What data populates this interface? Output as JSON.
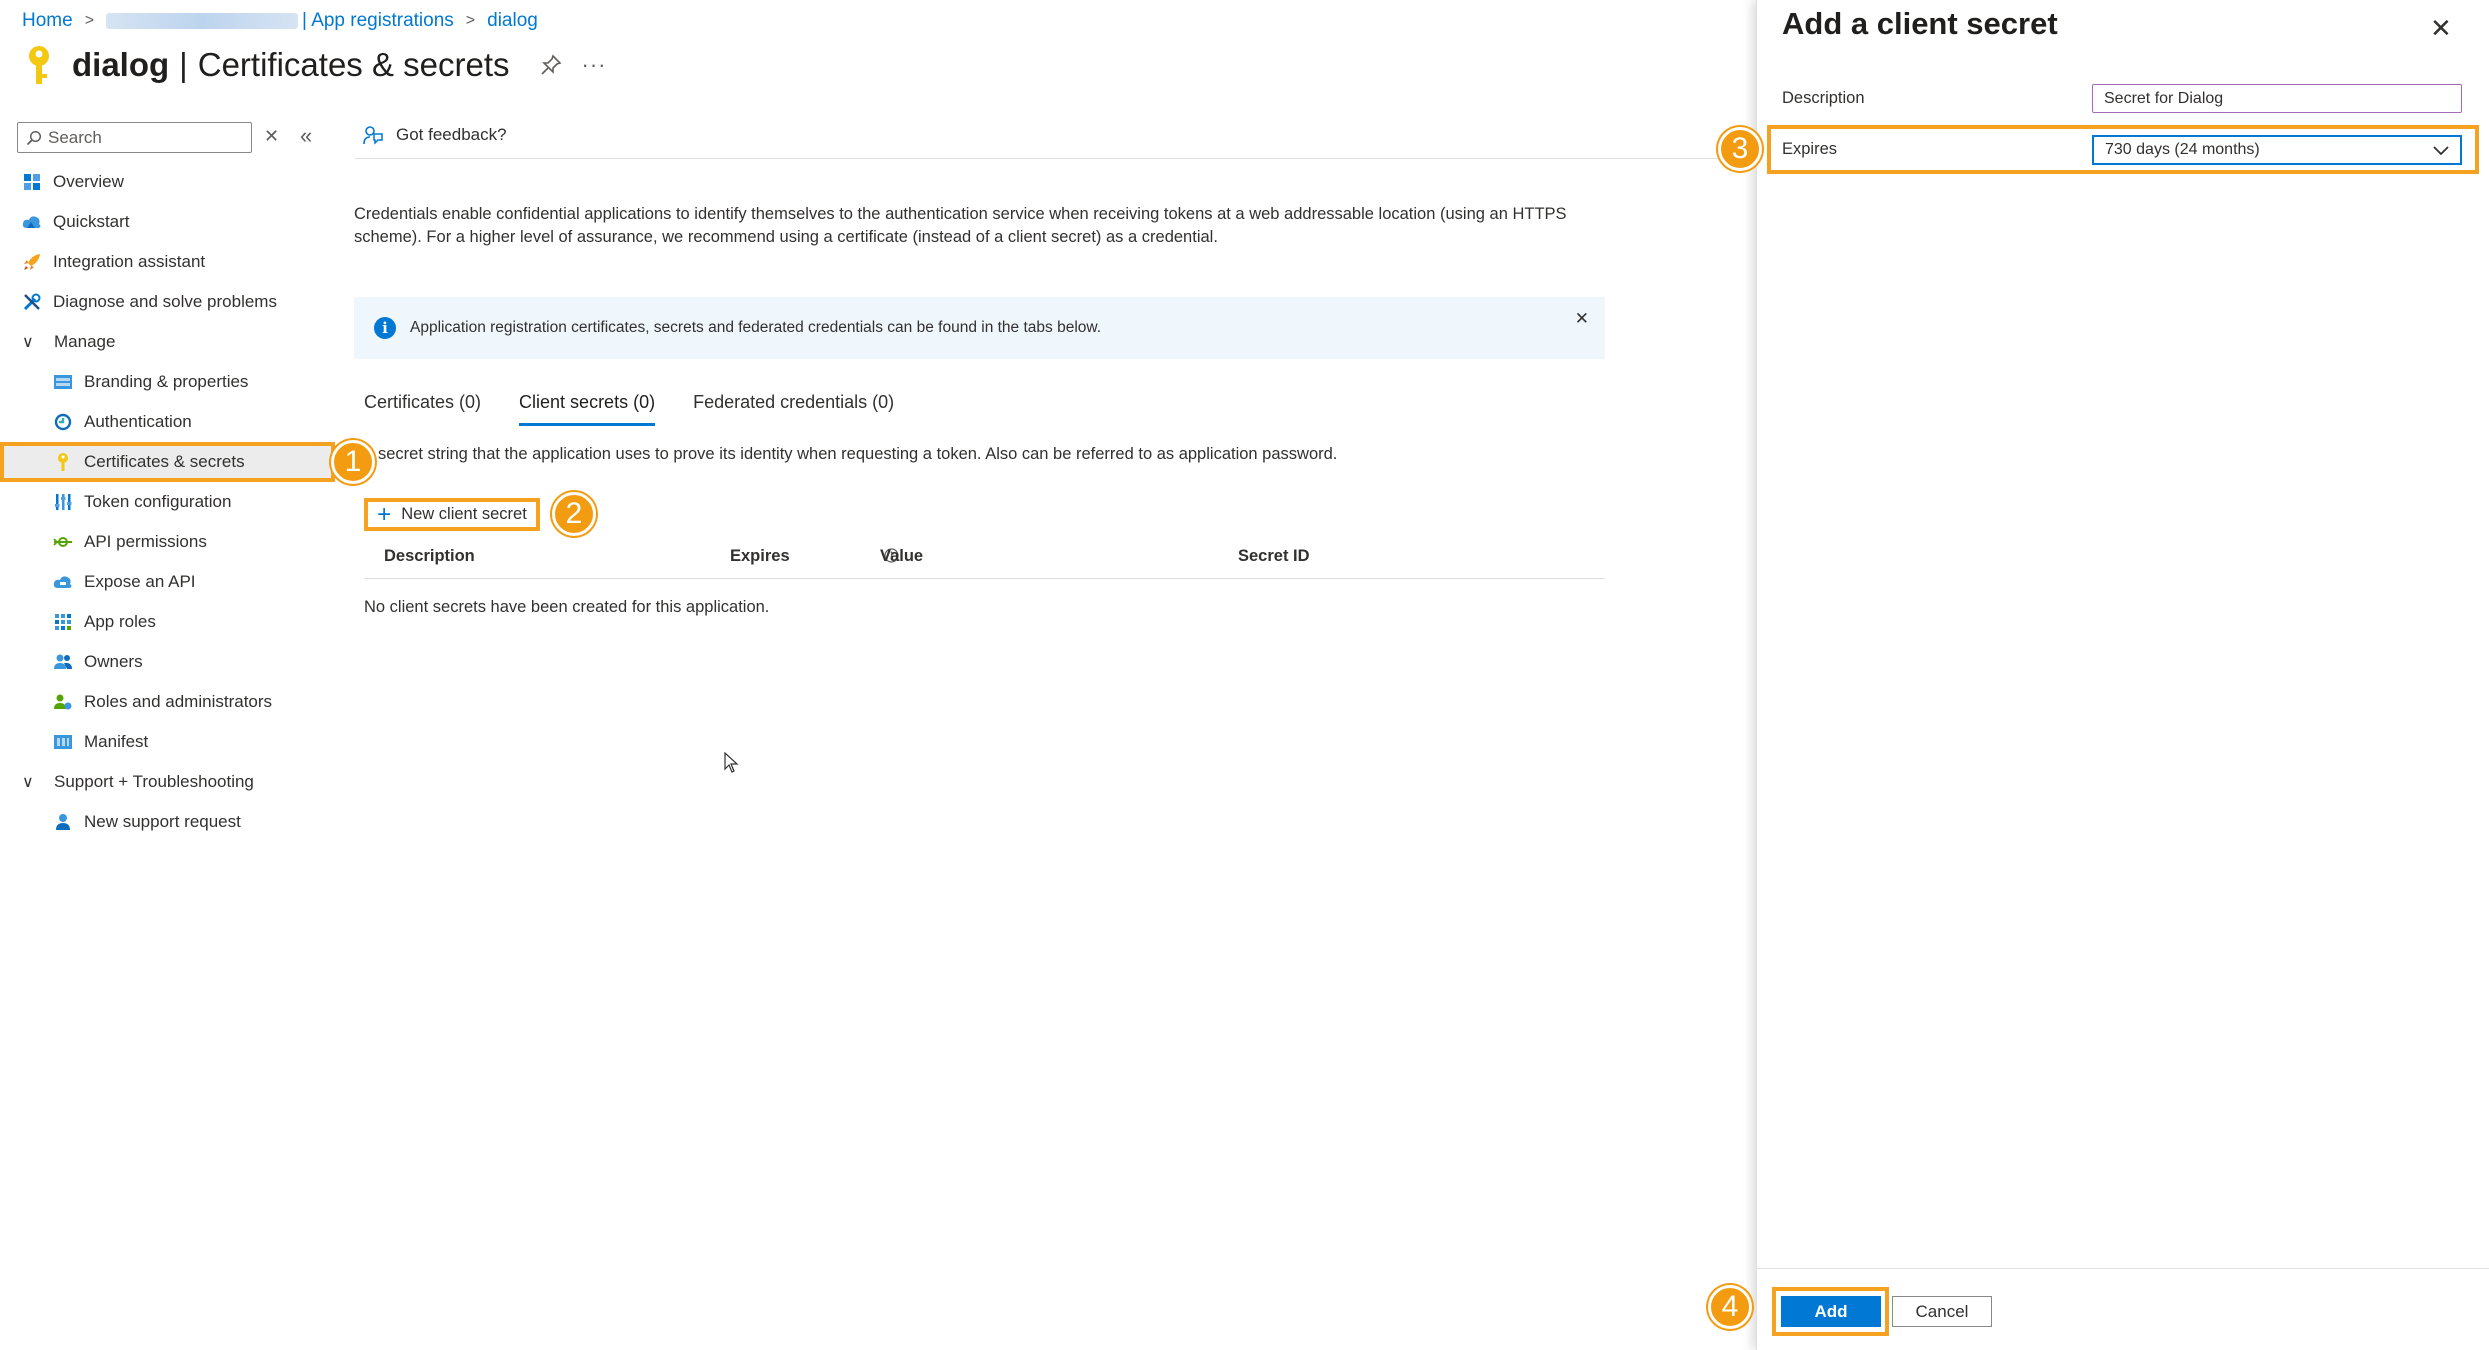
{
  "breadcrumb": {
    "home": "Home",
    "tenant_suffix": "| App registrations",
    "app": "dialog"
  },
  "page": {
    "title_name": "dialog",
    "title_separator": "|",
    "title_section": "Certificates & secrets",
    "more": "···"
  },
  "search": {
    "placeholder": "Search"
  },
  "sidebar": {
    "items": [
      {
        "label": "Overview",
        "icon": "overview-grid-icon"
      },
      {
        "label": "Quickstart",
        "icon": "quickstart-cloud-icon"
      },
      {
        "label": "Integration assistant",
        "icon": "rocket-icon"
      },
      {
        "label": "Diagnose and solve problems",
        "icon": "wrench-icon"
      }
    ],
    "manage_label": "Manage",
    "manage_items": [
      {
        "label": "Branding & properties",
        "icon": "branding-icon"
      },
      {
        "label": "Authentication",
        "icon": "authentication-icon"
      },
      {
        "label": "Certificates & secrets",
        "icon": "key-icon"
      },
      {
        "label": "Token configuration",
        "icon": "token-bars-icon"
      },
      {
        "label": "API permissions",
        "icon": "api-permissions-icon"
      },
      {
        "label": "Expose an API",
        "icon": "cloud-api-icon"
      },
      {
        "label": "App roles",
        "icon": "app-roles-grid-icon"
      },
      {
        "label": "Owners",
        "icon": "owners-people-icon"
      },
      {
        "label": "Roles and administrators",
        "icon": "roles-admin-icon"
      },
      {
        "label": "Manifest",
        "icon": "manifest-icon"
      }
    ],
    "support_label": "Support + Troubleshooting",
    "support_items": [
      {
        "label": "New support request",
        "icon": "support-person-icon"
      }
    ]
  },
  "content": {
    "feedback": "Got feedback?",
    "intro_line1": "Credentials enable confidential applications to identify themselves to the authentication service when receiving tokens at a web addressable location (using an HTTPS",
    "intro_line2": "scheme). For a higher level of assurance, we recommend using a certificate (instead of a client secret) as a credential.",
    "info_bar": "Application registration certificates, secrets and federated credentials can be found in the tabs below.",
    "tabs": [
      {
        "label": "Certificates (0)"
      },
      {
        "label": "Client secrets (0)"
      },
      {
        "label": "Federated credentials (0)"
      }
    ],
    "tab_description": "secret string that the application uses to prove its identity when requesting a token. Also can be referred to as application password.",
    "new_secret_button": "New client secret",
    "table_headers": [
      "Description",
      "Expires",
      "Value",
      "Secret ID"
    ],
    "empty_message": "No client secrets have been created for this application."
  },
  "panel": {
    "title": "Add a client secret",
    "description_label": "Description",
    "description_value": "Secret for Dialog",
    "expires_label": "Expires",
    "expires_value": "730 days (24 months)",
    "add_button": "Add",
    "cancel_button": "Cancel"
  },
  "annotations": [
    "1",
    "2",
    "3",
    "4"
  ],
  "colors": {
    "accent": "#0078d4",
    "highlight": "#f4a21f",
    "badge": "#f39c12",
    "info_background": "#eff6fc"
  }
}
